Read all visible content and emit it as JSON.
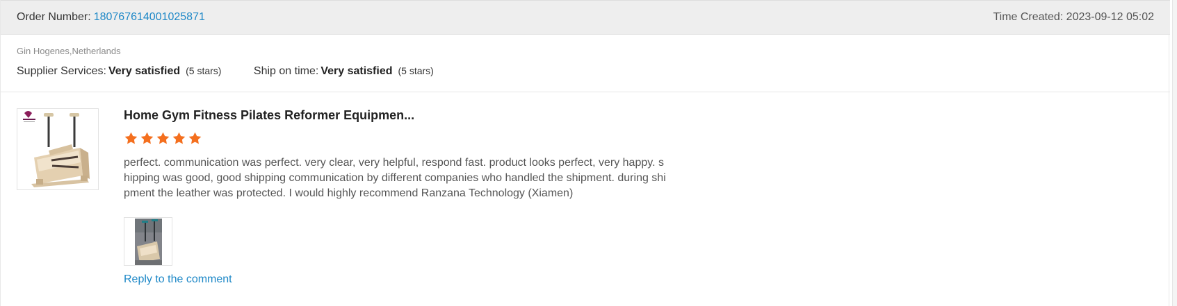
{
  "order": {
    "label": "Order Number:",
    "number": "180767614001025871",
    "time_created": "Time Created: 2023-09-12 05:02"
  },
  "buyer": "Gin Hogenes,Netherlands",
  "ratings": {
    "supplier": {
      "label": "Supplier Services:",
      "value": "Very satisfied",
      "stars": "(5 stars)"
    },
    "shipping": {
      "label": "Ship on time:",
      "value": "Very satisfied",
      "stars": "(5 stars)"
    }
  },
  "review": {
    "product_title": "Home Gym Fitness Pilates Reformer Equipmen...",
    "rating": 5,
    "text": "perfect. communication was perfect. very clear, very helpful,  respond fast. product looks perfect, very happy. shipping was good, good shipping communication by different companies who handled the shipment. during shipment the leather was protected. I would highly recommend Ranzana Technology (Xiamen)",
    "reply_label": "Reply to the comment"
  },
  "images": {
    "product_thumbnail": "pilates-chair-thumbnail",
    "review_photo": "customer-photo-thumbnail"
  },
  "colors": {
    "header_bg": "#eeeeee",
    "link": "#1e88c7",
    "star": "#f46f1e",
    "muted_text": "#8a8a8a",
    "body_text": "#555555"
  }
}
